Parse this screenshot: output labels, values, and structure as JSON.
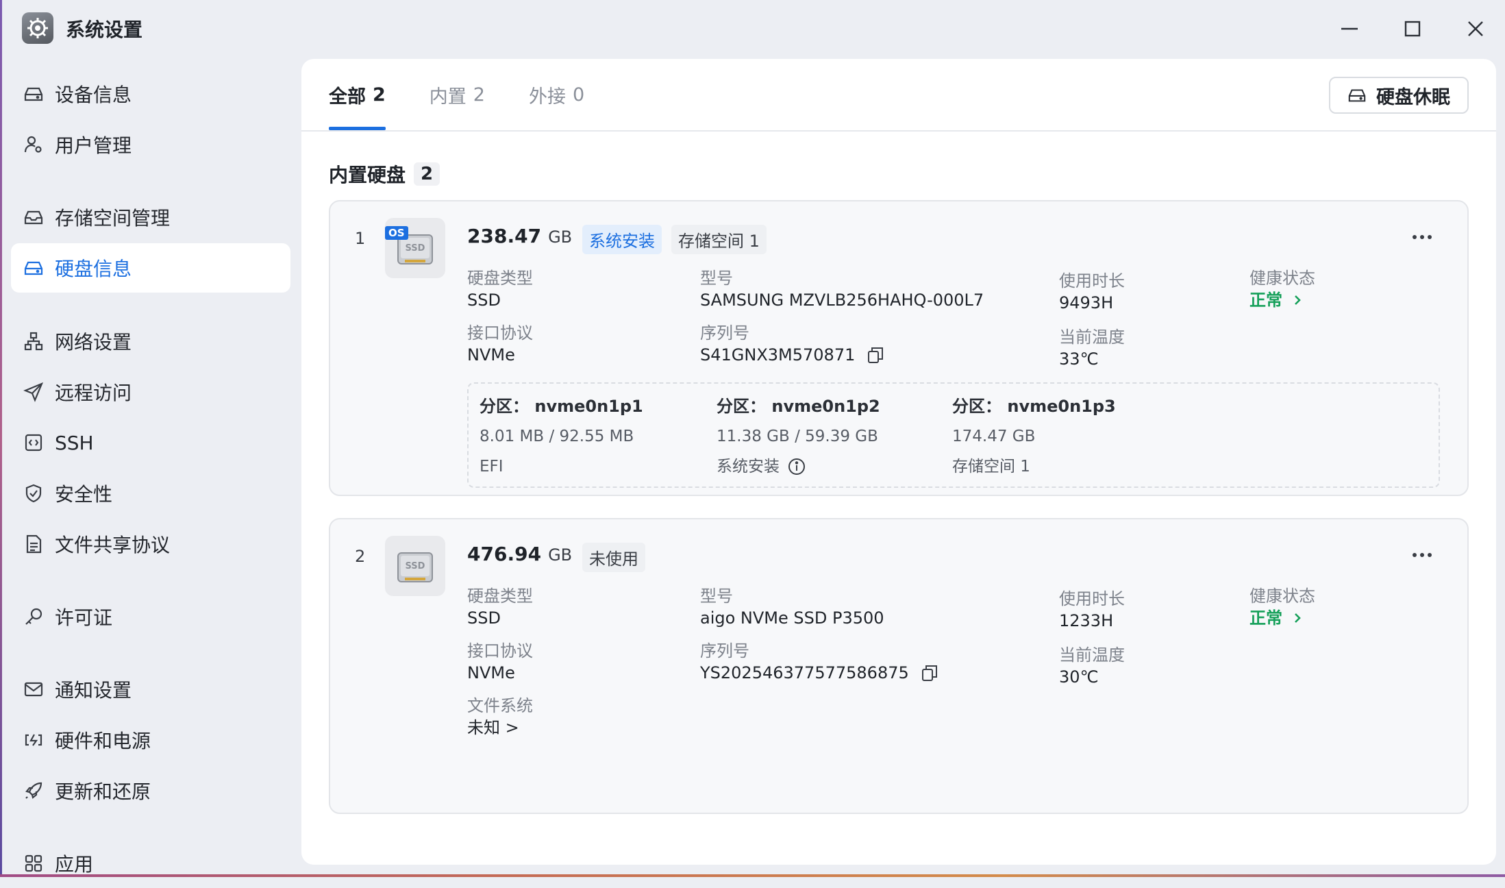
{
  "window": {
    "title": "系统设置"
  },
  "sidebar": {
    "items": [
      {
        "label": "设备信息",
        "icon": "drive-icon"
      },
      {
        "label": "用户管理",
        "icon": "user-gear-icon"
      },
      {
        "label": "存储空间管理",
        "icon": "storage-icon"
      },
      {
        "label": "硬盘信息",
        "icon": "disk-icon",
        "active": true
      },
      {
        "label": "网络设置",
        "icon": "network-icon"
      },
      {
        "label": "远程访问",
        "icon": "send-icon"
      },
      {
        "label": "SSH",
        "icon": "code-icon"
      },
      {
        "label": "安全性",
        "icon": "shield-icon"
      },
      {
        "label": "文件共享协议",
        "icon": "document-icon"
      },
      {
        "label": "许可证",
        "icon": "key-icon"
      },
      {
        "label": "通知设置",
        "icon": "mail-icon"
      },
      {
        "label": "硬件和电源",
        "icon": "power-icon"
      },
      {
        "label": "更新和还原",
        "icon": "rocket-icon"
      },
      {
        "label": "应用",
        "icon": "apps-icon"
      }
    ]
  },
  "tabs": [
    {
      "label": "全部",
      "count": "2",
      "active": true
    },
    {
      "label": "内置",
      "count": "2"
    },
    {
      "label": "外接",
      "count": "0"
    }
  ],
  "toolbar": {
    "sleep_label": "硬盘休眠"
  },
  "section": {
    "title": "内置硬盘",
    "count": "2"
  },
  "labels": {
    "type": "硬盘类型",
    "model": "型号",
    "uptime": "使用时长",
    "health": "健康状态",
    "interface": "接口协议",
    "serial": "序列号",
    "temp": "当前温度",
    "fs": "文件系统",
    "partition_prefix": "分区："
  },
  "disks": [
    {
      "index": "1",
      "size": "238.47",
      "unit": "GB",
      "os_badge": "OS",
      "badges": [
        "系统安装",
        "存储空间 1"
      ],
      "type": "SSD",
      "model": "SAMSUNG MZVLB256HAHQ-000L7",
      "uptime": "9493H",
      "health": "正常",
      "interface": "NVMe",
      "serial": "S41GNX3M570871",
      "temp": "33℃",
      "partitions": [
        {
          "name": "nvme0n1p1",
          "usage": "8.01 MB / 92.55 MB",
          "role": "EFI"
        },
        {
          "name": "nvme0n1p2",
          "usage": "11.38 GB / 59.39 GB",
          "role": "系统安装"
        },
        {
          "name": "nvme0n1p3",
          "usage": "174.47 GB",
          "role": "存储空间 1"
        }
      ]
    },
    {
      "index": "2",
      "size": "476.94",
      "unit": "GB",
      "badges": [
        "未使用"
      ],
      "type": "SSD",
      "model": "aigo NVMe SSD P3500",
      "uptime": "1233H",
      "health": "正常",
      "interface": "NVMe",
      "serial": "YS202546377577586875",
      "temp": "30℃",
      "fs": "未知 >"
    }
  ],
  "colors": {
    "accent": "#1c6fe0",
    "ok": "#16a05a",
    "bg": "#eceef3"
  }
}
